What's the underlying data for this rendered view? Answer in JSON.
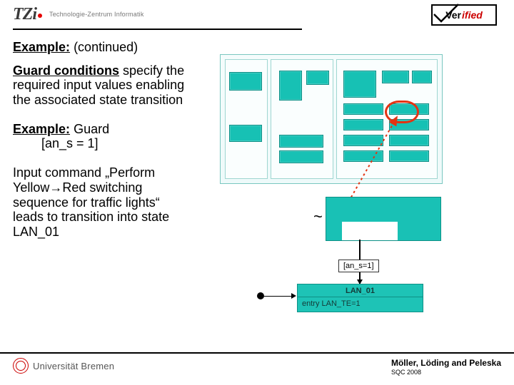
{
  "header": {
    "logo_text": "TZi",
    "logo_subtitle": "Technologie-Zentrum Informatik",
    "badge_prefix": "Ver",
    "badge_suffix": "ified"
  },
  "body": {
    "example_label": "Example:",
    "continued": "(continued)",
    "guard_heading": "Guard conditions",
    "guard_text": "specify the required input values enabling the associated state transition",
    "example2_label": "Example:",
    "example2_text": "Guard",
    "guard_expr": "[an_s = 1]",
    "input_cmd": "Input command „Perform Yellow→Red switching sequence for traffic lights“ leads to transition into state LAN_01"
  },
  "diagram": {
    "detail_guard_label": "[an_s=1]",
    "lan_title": "LAN_01",
    "lan_entry": "entry LAN_TE=1"
  },
  "footer": {
    "university": "Universität Bremen",
    "authors": "Möller, Löding and Peleska",
    "venue": "SQC 2008"
  }
}
